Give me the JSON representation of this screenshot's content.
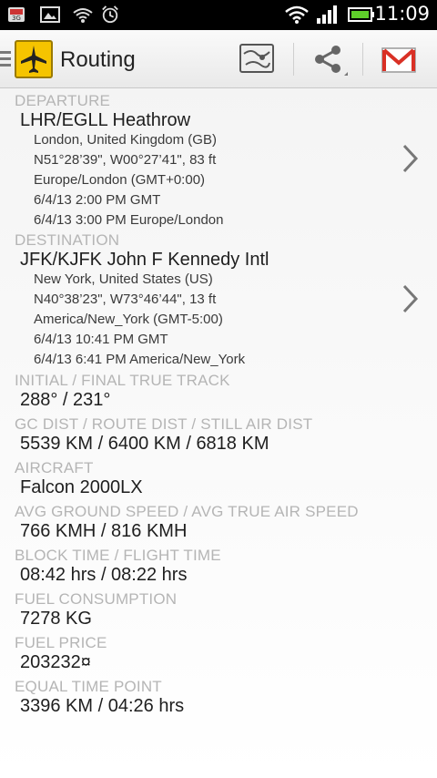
{
  "status_bar": {
    "time": "11:09",
    "icons": [
      "3g-icon",
      "gallery-icon",
      "wifi-call-icon",
      "alarm-icon",
      "wifi-icon",
      "signal-icon",
      "battery-icon"
    ]
  },
  "action_bar": {
    "title": "Routing",
    "buttons": [
      "map-icon",
      "share-icon",
      "gmail-icon"
    ]
  },
  "departure": {
    "label": "DEPARTURE",
    "airport": "LHR/EGLL Heathrow",
    "location": "London, United Kingdom (GB)",
    "coords": "N51°28’39\", W00°27’41\", 83 ft",
    "timezone": "Europe/London (GMT+0:00)",
    "time_gmt": "6/4/13 2:00 PM GMT",
    "time_local": "6/4/13 3:00 PM Europe/London"
  },
  "destination": {
    "label": "DESTINATION",
    "airport": "JFK/KJFK John F Kennedy Intl",
    "location": "New York, United States (US)",
    "coords": "N40°38’23\", W73°46’44\", 13 ft",
    "timezone": "America/New_York (GMT-5:00)",
    "time_gmt": "6/4/13 10:41 PM GMT",
    "time_local": "6/4/13 6:41 PM America/New_York"
  },
  "track": {
    "label": "INITIAL / FINAL TRUE TRACK",
    "value": "288° / 231°"
  },
  "distance": {
    "label": "GC DIST / ROUTE DIST / STILL AIR DIST",
    "value": "5539 KM / 6400 KM / 6818 KM"
  },
  "aircraft": {
    "label": "AIRCRAFT",
    "value": "Falcon 2000LX"
  },
  "speed": {
    "label": "AVG GROUND SPEED / AVG TRUE AIR SPEED",
    "value": "766 KMH / 816 KMH"
  },
  "block_time": {
    "label": "BLOCK TIME / FLIGHT TIME",
    "value": "08:42 hrs / 08:22 hrs"
  },
  "fuel_consumption": {
    "label": "FUEL CONSUMPTION",
    "value": "7278 KG"
  },
  "fuel_price": {
    "label": "FUEL PRICE",
    "value": "203232¤"
  },
  "etp": {
    "label": "EQUAL TIME POINT",
    "value": "3396 KM / 04:26 hrs"
  },
  "colors": {
    "accent": "#f5c400",
    "label_gray": "#b5b5b5",
    "gmail_red": "#d93025"
  }
}
